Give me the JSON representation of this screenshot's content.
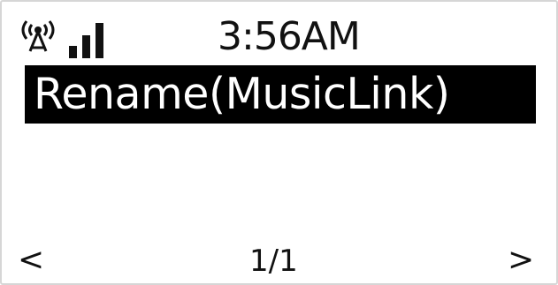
{
  "status": {
    "time": "3:56AM",
    "antenna_icon": "wifi-antenna-icon",
    "signal_icon": "signal-strength-icon"
  },
  "menu": {
    "selected_item": "Rename(MusicLink)"
  },
  "footer": {
    "prev_label": "<",
    "page": "1/1",
    "next_label": ">"
  },
  "colors": {
    "background": "#ffffff",
    "foreground": "#111111",
    "highlight": "#000000",
    "highlight_text": "#ffffff"
  }
}
